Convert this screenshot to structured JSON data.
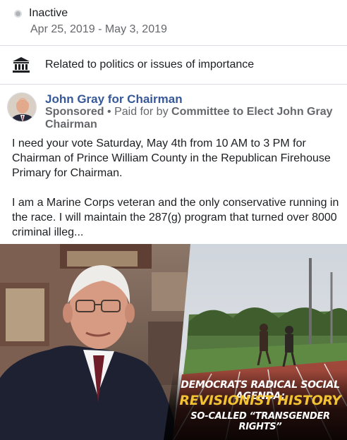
{
  "status": {
    "label": "Inactive",
    "date_range": "Apr 25, 2019 - May 3, 2019"
  },
  "category": {
    "icon": "government-building-icon",
    "label": "Related to politics or issues of importance"
  },
  "ad": {
    "page_name": "John Gray for Chairman",
    "sponsored_label": "Sponsored",
    "separator": "•",
    "paid_for_prefix": "Paid for by",
    "paid_for_by": "Committee to Elect John Gray Chairman",
    "body_paragraph_1": "I need your vote Saturday, May 4th from 10 AM to 3 PM for Chairman of Prince William County in the Republican Firehouse Primary for Chairman.",
    "body_paragraph_2": "I am a Marine Corps veteran and the only conservative running in the race. I will maintain the 287(g) program that turned over 8000 criminal illeg...",
    "image": {
      "caption_line_1": "Democrats Radical Social Agenda:",
      "caption_line_2": "Revisionist History",
      "caption_line_3": "So-Called “Transgender Rights”",
      "caption_accent_color": "#f1c232"
    }
  }
}
